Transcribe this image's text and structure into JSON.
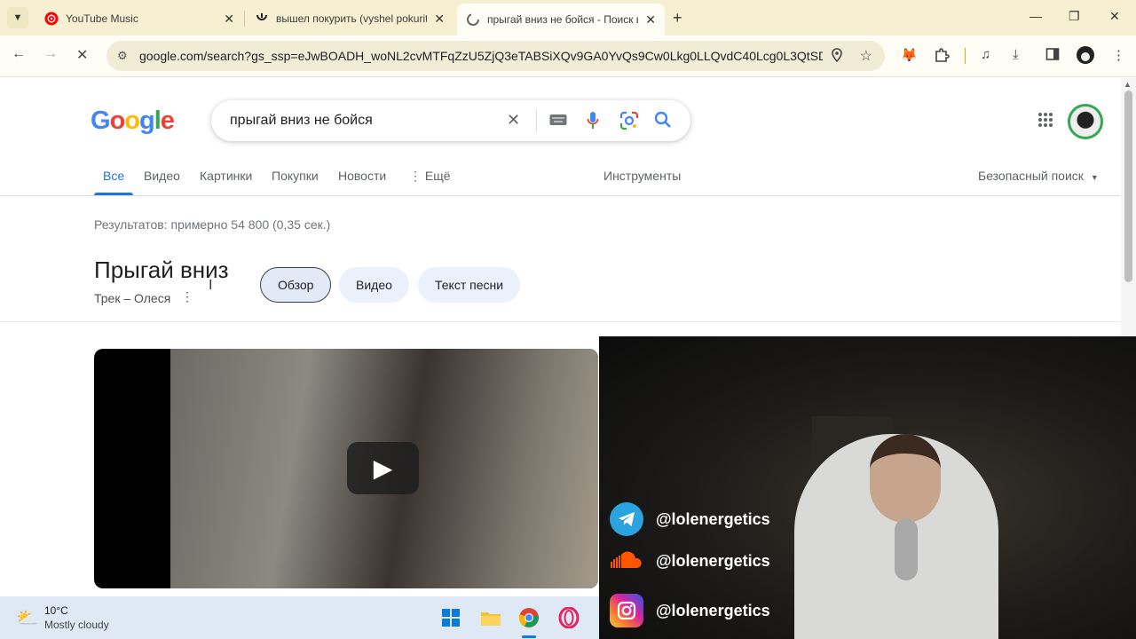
{
  "browser": {
    "tabs": [
      {
        "title": "YouTube Music"
      },
      {
        "title": "вышел покурить (vyshel pokurit"
      },
      {
        "title": "прыгай вниз не бойся - Поиск в"
      }
    ],
    "url": "google.com/search?gs_ssp=eJwBOADH_woNL2cvMTFqZzU5ZjQ3eTABSiXQv9GA0YvQs9Cw0Lkg0LLQvdC40Lcg0L3QtSDQsd..."
  },
  "google": {
    "logo": [
      "G",
      "o",
      "o",
      "g",
      "l",
      "e"
    ],
    "query": "прыгай вниз не бойся",
    "nav": {
      "all": "Все",
      "video": "Видео",
      "images": "Картинки",
      "shopping": "Покупки",
      "news": "Новости",
      "more": "Ещё",
      "tools": "Инструменты",
      "safesearch": "Безопасный поиск"
    },
    "results_count": "Результатов: примерно 54 800 (0,35 сек.)",
    "knowledge_panel": {
      "title": "Прыгай вниз",
      "subtitle": "Трек – Олеся",
      "chips": [
        "Обзор",
        "Видео",
        "Текст песни"
      ]
    }
  },
  "taskbar": {
    "temperature": "10°C",
    "condition": "Mostly cloudy"
  },
  "overlay": {
    "socials": [
      {
        "network": "telegram",
        "handle": "@lolenergetics",
        "color": "#2aa3df"
      },
      {
        "network": "soundcloud",
        "handle": "@lolenergetics",
        "color": "#ff5500"
      },
      {
        "network": "instagram",
        "handle": "@lolenergetics",
        "color": "#d6249f"
      }
    ]
  }
}
